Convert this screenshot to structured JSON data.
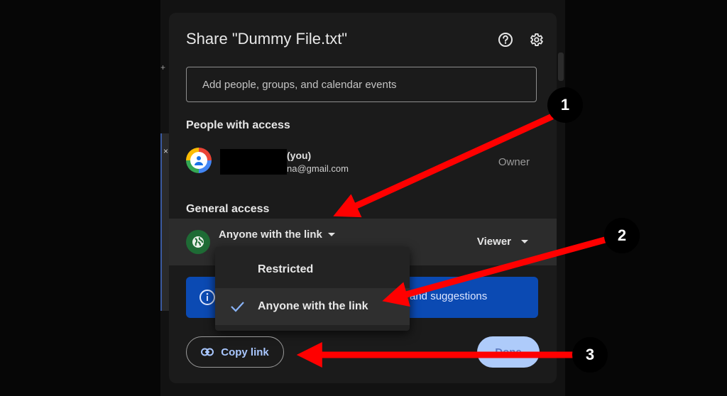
{
  "dialog": {
    "title": "Share \"Dummy File.txt\"",
    "help_icon": "help-icon",
    "settings_icon": "gear-icon",
    "add_people_placeholder": "Add people, groups, and calendar events"
  },
  "people_section": {
    "heading": "People with access",
    "user": {
      "name_suffix": "(you)",
      "email_visible": "na@gmail.com",
      "role": "Owner"
    }
  },
  "general_access": {
    "heading": "General access",
    "selected": "Anyone with the link",
    "role": "Viewer",
    "menu": {
      "options": [
        "Restricted",
        "Anyone with the link"
      ],
      "checked_index": 1
    }
  },
  "info_bar": {
    "text_visible": "and suggestions"
  },
  "footer": {
    "copy_link": "Copy link",
    "done": "Done"
  },
  "annotations": {
    "labels": [
      "1",
      "2",
      "3"
    ],
    "arrow_color": "#ff0000"
  },
  "colors": {
    "dialog_bg": "#1b1b1b",
    "info_bar": "#0b4ab3",
    "link_blue": "#a9c7ff",
    "done_bg": "#aecbfa"
  }
}
